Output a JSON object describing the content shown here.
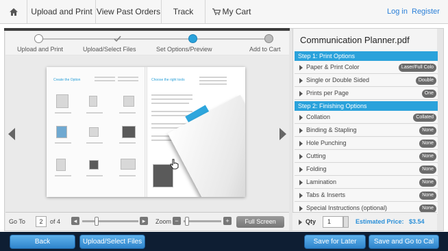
{
  "nav": {
    "items": [
      "Upload and Print",
      "View Past Orders",
      "Track",
      "My Cart"
    ],
    "login": "Log in",
    "register": "Register"
  },
  "steps": [
    "Upload and Print",
    "Upload/Select Files",
    "Set Options/Preview",
    "Add to Cart"
  ],
  "viewer": {
    "goto_label": "Go To",
    "page_value": "2",
    "page_total": "of 4",
    "zoom_label": "Zoom",
    "fullscreen": "Full Screen"
  },
  "panel": {
    "filename": "Communication Planner.pdf",
    "section1": "Step 1: Print Options",
    "print_options": [
      {
        "label": "Paper & Print Color",
        "value": "Laser/Full Colo"
      },
      {
        "label": "Single or Double Sided",
        "value": "Double"
      },
      {
        "label": "Prints per Page",
        "value": "One"
      }
    ],
    "section2": "Step 2: Finishing Options",
    "finishing_options": [
      {
        "label": "Collation",
        "value": "Collated"
      },
      {
        "label": "Binding & Stapling",
        "value": "None"
      },
      {
        "label": "Hole Punching",
        "value": "None"
      },
      {
        "label": "Cutting",
        "value": "None"
      },
      {
        "label": "Folding",
        "value": "None"
      },
      {
        "label": "Lamination",
        "value": "None"
      },
      {
        "label": "Tabs & Inserts",
        "value": "None"
      },
      {
        "label": "Special Instructions (optional)",
        "value": "None"
      }
    ],
    "qty_label": "Qty",
    "qty_value": "1",
    "est_label": "Estimated Price:",
    "est_value": "$3.54"
  },
  "document": {
    "left_title": "Create the Option",
    "right_title": "Choose the right tools"
  },
  "actions": {
    "back": "Back",
    "upload": "Upload/Select Files",
    "save_later": "Save for Later",
    "save_cart": "Save and Go to Cal"
  },
  "colors": {
    "accent": "#2aa2db",
    "button": "#3b8fd6",
    "actionbar": "#0e1e33"
  }
}
